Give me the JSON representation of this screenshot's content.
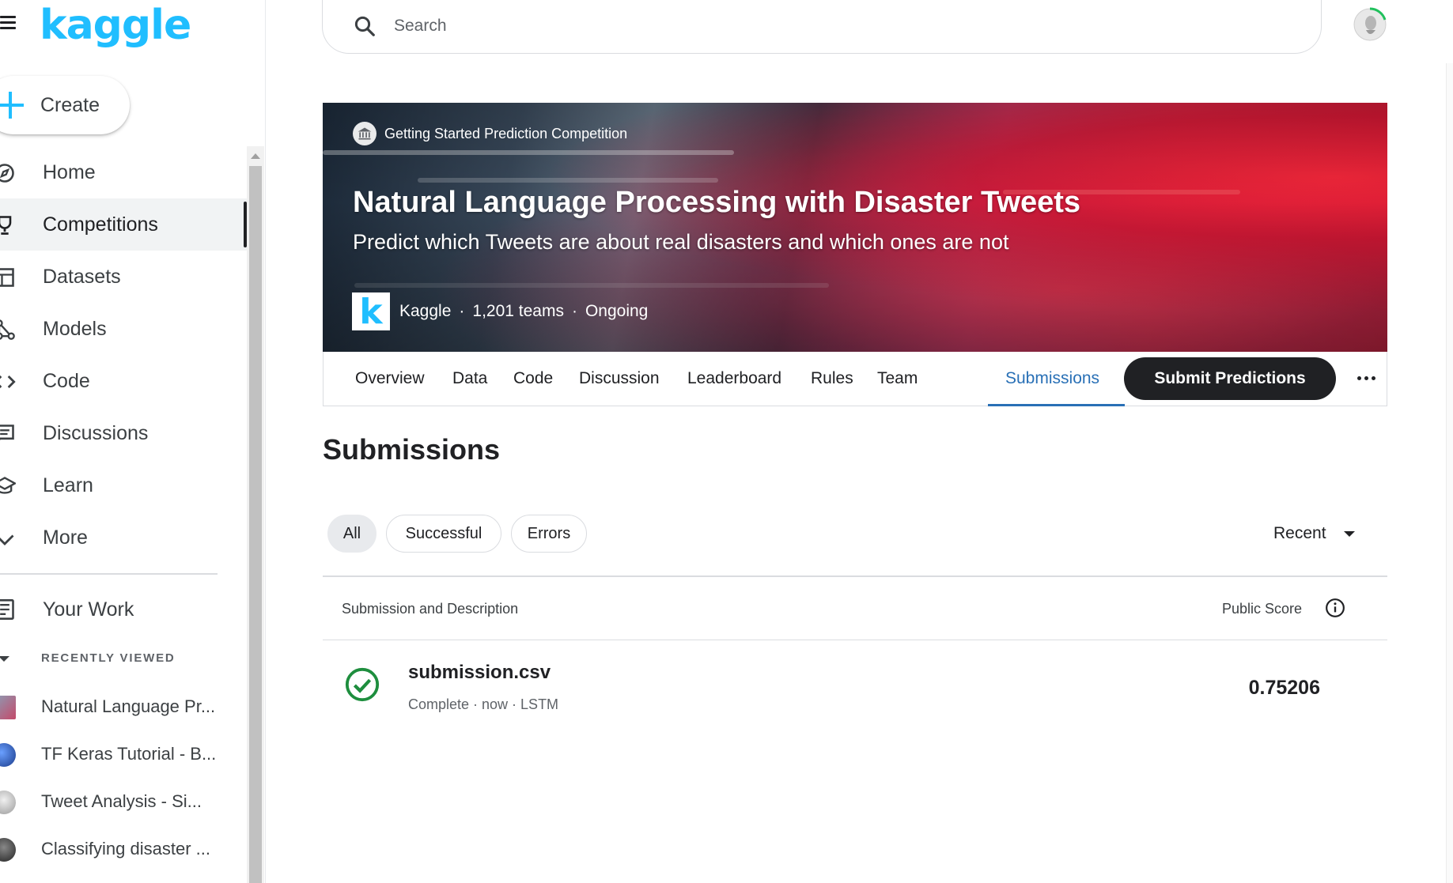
{
  "sidebar": {
    "logo": "kaggle",
    "create_label": "Create",
    "items": [
      {
        "label": "Home",
        "icon": "compass-icon"
      },
      {
        "label": "Competitions",
        "icon": "trophy-icon",
        "active": true
      },
      {
        "label": "Datasets",
        "icon": "table-icon"
      },
      {
        "label": "Models",
        "icon": "models-icon"
      },
      {
        "label": "Code",
        "icon": "code-icon"
      },
      {
        "label": "Discussions",
        "icon": "comment-icon"
      },
      {
        "label": "Learn",
        "icon": "school-icon"
      },
      {
        "label": "More",
        "icon": "chevron-down-icon"
      }
    ],
    "your_work": "Your Work",
    "recently_viewed_label": "RECENTLY VIEWED",
    "recent": [
      {
        "label": "Natural Language Pr..."
      },
      {
        "label": "TF Keras Tutorial - B..."
      },
      {
        "label": "Tweet Analysis - Si..."
      },
      {
        "label": "Classifying disaster ..."
      }
    ]
  },
  "search": {
    "placeholder": "Search"
  },
  "banner": {
    "tag": "Getting Started Prediction Competition",
    "title": "Natural Language Processing with Disaster Tweets",
    "subtitle": "Predict which Tweets are about real disasters and which ones are not",
    "host": "Kaggle",
    "teams": "1,201 teams",
    "status": "Ongoing",
    "host_logo_letter": "k"
  },
  "tabs": {
    "items": [
      "Overview",
      "Data",
      "Code",
      "Discussion",
      "Leaderboard",
      "Rules",
      "Team"
    ],
    "active": "Submissions",
    "submit_label": "Submit Predictions"
  },
  "submissions": {
    "title": "Submissions",
    "filters": [
      "All",
      "Successful",
      "Errors"
    ],
    "active_filter": "All",
    "sort": "Recent",
    "col_left": "Submission and Description",
    "col_right": "Public Score",
    "rows": [
      {
        "name": "submission.csv",
        "meta": "Complete · now · LSTM",
        "score": "0.75206",
        "status": "success"
      }
    ]
  },
  "colors": {
    "brand": "#20beff",
    "active_tab": "#2970b6",
    "success": "#1e8e3e",
    "dark_button": "#202124"
  }
}
